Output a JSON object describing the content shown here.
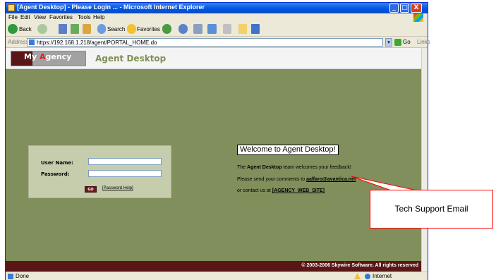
{
  "window": {
    "title": "[Agent Desktop] - Please Login ... - Microsoft Internet Explorer",
    "controls": [
      "_",
      "□",
      "X"
    ]
  },
  "menubar": [
    "File",
    "Edit",
    "View",
    "Favorites",
    "Tools",
    "Help"
  ],
  "toolbar": {
    "back_label": "Back",
    "search_label": "Search",
    "favorites_label": "Favorites"
  },
  "addressbar": {
    "label": "Address",
    "url": "https://192.168.1.218/agent/PORTAL_HOME.do",
    "go_label": "Go",
    "links_label": "Links"
  },
  "header": {
    "logo_my": "My",
    "logo_a": "A",
    "logo_rest": "gency",
    "page_title": "Agent Desktop"
  },
  "login": {
    "username_label": "User Name:",
    "password_label": "Password:",
    "username_value": "",
    "password_value": "",
    "go_button": "GO",
    "password_help": "[Password Help]"
  },
  "welcome": {
    "heading": "Welcome to Agent Desktop!",
    "line1_prefix": "The",
    "line1_bold": "Agent Desktop",
    "line1_suffix": "team welcomes your feedback!",
    "line2_prefix": "Please send your comments to",
    "support_email": "aalfaro@avantica.net",
    "line3_prefix": "or contact us at",
    "website_link": "[AGENCY  WEB  SITE]"
  },
  "footer": {
    "copyright": "© 2003-2006 Skywire Software. All rights reserved"
  },
  "statusbar": {
    "status": "Done",
    "zone": "Internet"
  },
  "callout": {
    "text": "Tech Support Email",
    "color": "#FF0000"
  },
  "colors": {
    "page_background": "#808F5C",
    "brand_maroon": "#5A1616",
    "title_green": "#7F9056"
  }
}
